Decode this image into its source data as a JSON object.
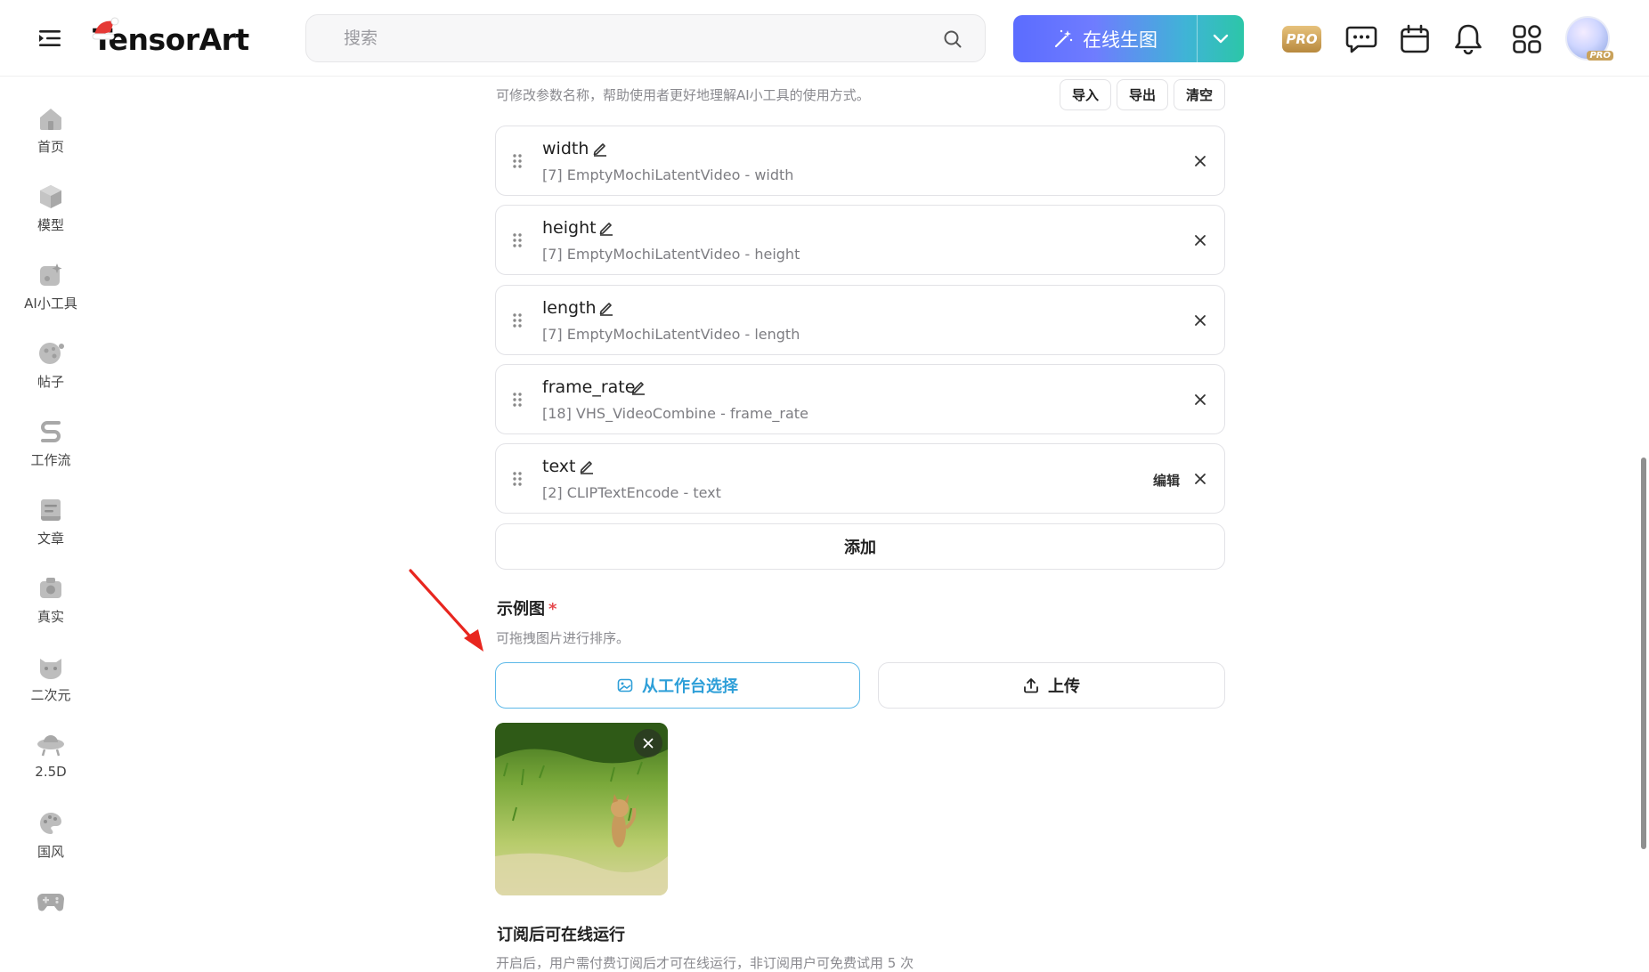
{
  "app": {
    "logo_text": "TensorArt",
    "search_placeholder": "搜索",
    "generate_label": "在线生图",
    "pro_label": "PRO",
    "avatar_badge": "PRO"
  },
  "sidebar": {
    "items": [
      {
        "label": "首页",
        "icon": "home-icon"
      },
      {
        "label": "模型",
        "icon": "cube-icon"
      },
      {
        "label": "AI小工具",
        "icon": "ai-tools-icon"
      },
      {
        "label": "帖子",
        "icon": "posts-icon"
      },
      {
        "label": "工作流",
        "icon": "workflow-icon"
      },
      {
        "label": "文章",
        "icon": "article-icon"
      },
      {
        "label": "真实",
        "icon": "camera-icon"
      },
      {
        "label": "二次元",
        "icon": "anime-cat-icon"
      },
      {
        "label": "2.5D",
        "icon": "ufo-icon"
      },
      {
        "label": "国风",
        "icon": "palette-icon"
      },
      {
        "label": "",
        "icon": "gamepad-icon"
      }
    ]
  },
  "params": {
    "hint": "可修改参数名称，帮助使用者更好地理解AI小工具的使用方式。",
    "import_label": "导入",
    "export_label": "导出",
    "clear_label": "清空",
    "items": [
      {
        "name": "width",
        "source": "[7] EmptyMochiLatentVideo - width",
        "edit_link": ""
      },
      {
        "name": "height",
        "source": "[7] EmptyMochiLatentVideo - height",
        "edit_link": ""
      },
      {
        "name": "length",
        "source": "[7] EmptyMochiLatentVideo - length",
        "edit_link": ""
      },
      {
        "name": "frame_rate",
        "source": "[18] VHS_VideoCombine - frame_rate",
        "edit_link": ""
      },
      {
        "name": "text",
        "source": "[2] CLIPTextEncode - text",
        "edit_link": "编辑"
      }
    ],
    "add_label": "添加"
  },
  "examples": {
    "title": "示例图",
    "required_mark": "*",
    "hint": "可拖拽图片进行排序。",
    "pick_label": "从工作台选择",
    "upload_label": "上传"
  },
  "subscription": {
    "title": "订阅后可在线运行",
    "text": "开启后，用户需付费订阅后才可在线运行，非订阅用户可免费试用 5 次"
  },
  "colors": {
    "accent_blue": "#2e9fd8",
    "required_red": "#e5484d",
    "arrow_red": "#e8261f"
  }
}
